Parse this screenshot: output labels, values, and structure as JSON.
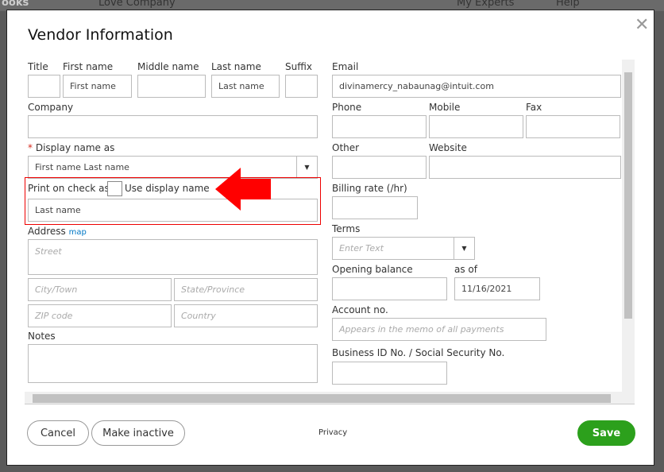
{
  "background": {
    "brand": "ooks",
    "company": "Love Company",
    "experts": "My Experts",
    "help": "Help"
  },
  "title": "Vendor Information",
  "close_icon": "close-icon",
  "fields": {
    "title_label": "Title",
    "first_label": "First name",
    "first_ph": "First name",
    "middle_label": "Middle name",
    "last_label": "Last name",
    "last_ph": "Last name",
    "suffix_label": "Suffix",
    "email_label": "Email",
    "email_value": "divinamercy_nabaunag@intuit.com",
    "company_label": "Company",
    "phone_label": "Phone",
    "mobile_label": "Mobile",
    "fax_label": "Fax",
    "display_req": "*",
    "display_label": "Display name as",
    "display_value": "First name Last name",
    "other_label": "Other",
    "website_label": "Website",
    "print_label": "Print on check as",
    "use_display": "Use display name",
    "print_value": "Last name",
    "billing_label": "Billing rate (/hr)",
    "address_label": "Address",
    "map_link": "map",
    "street_ph": "Street",
    "city_ph": "City/Town",
    "state_ph": "State/Province",
    "zip_ph": "ZIP code",
    "country_ph": "Country",
    "terms_label": "Terms",
    "terms_ph": "Enter Text",
    "opening_label": "Opening balance",
    "asof_label": "as of",
    "asof_value": "11/16/2021",
    "account_label": "Account no.",
    "account_ph": "Appears in the memo of all payments",
    "notes_label": "Notes",
    "business_label": "Business ID No. / Social Security No."
  },
  "footer": {
    "cancel": "Cancel",
    "inactive": "Make inactive",
    "privacy": "Privacy",
    "save": "Save"
  },
  "colors": {
    "accent": "#2ca01c",
    "highlight": "#e00000"
  }
}
